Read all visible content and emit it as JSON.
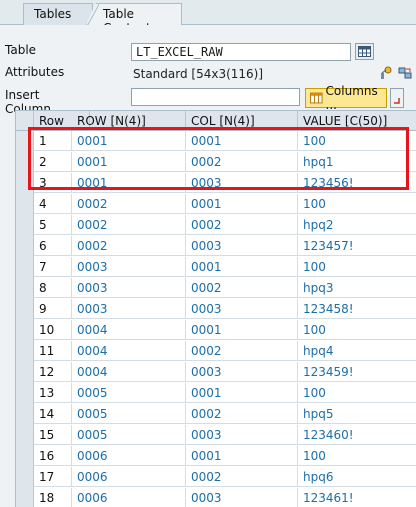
{
  "tabs": [
    {
      "label": "Tables"
    },
    {
      "label": "Table Contents",
      "active": true
    }
  ],
  "form": {
    "table_label": "Table",
    "table_value": "LT_EXCEL_RAW",
    "attributes_label": "Attributes",
    "attributes_value": "Standard [54x3(116)]",
    "insert_label": "Insert Column",
    "insert_value": "",
    "columns_button": "Columns ..."
  },
  "grid": {
    "headers": [
      "Row",
      "ROW [N(4)]",
      "COL [N(4)]",
      "VALUE [C(50)]"
    ],
    "rows": [
      [
        "1",
        "0001",
        "0001",
        "100"
      ],
      [
        "2",
        "0001",
        "0002",
        "hpq1"
      ],
      [
        "3",
        "0001",
        "0003",
        "123456!"
      ],
      [
        "4",
        "0002",
        "0001",
        "100"
      ],
      [
        "5",
        "0002",
        "0002",
        "hpq2"
      ],
      [
        "6",
        "0002",
        "0003",
        "123457!"
      ],
      [
        "7",
        "0003",
        "0001",
        "100"
      ],
      [
        "8",
        "0003",
        "0002",
        "hpq3"
      ],
      [
        "9",
        "0003",
        "0003",
        "123458!"
      ],
      [
        "10",
        "0004",
        "0001",
        "100"
      ],
      [
        "11",
        "0004",
        "0002",
        "hpq4"
      ],
      [
        "12",
        "0004",
        "0003",
        "123459!"
      ],
      [
        "13",
        "0005",
        "0001",
        "100"
      ],
      [
        "14",
        "0005",
        "0002",
        "hpq5"
      ],
      [
        "15",
        "0005",
        "0003",
        "123460!"
      ],
      [
        "16",
        "0006",
        "0001",
        "100"
      ],
      [
        "17",
        "0006",
        "0002",
        "hpq6"
      ],
      [
        "18",
        "0006",
        "0003",
        "123461!"
      ]
    ]
  },
  "colors": {
    "highlight": "#e8141b",
    "value_text": "#1c6ea7",
    "columns_button": "#fce892"
  }
}
